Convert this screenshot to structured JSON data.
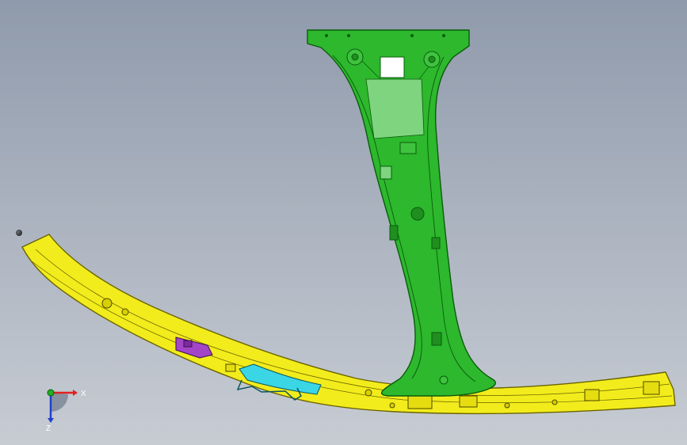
{
  "viewport": {
    "background_top": "#8f9aab",
    "background_bottom": "#c7ccd3"
  },
  "parts": {
    "pillar": {
      "name_icon": "b-pillar-part",
      "color": "#2db82d",
      "edge": "#0b5c0b"
    },
    "rail": {
      "name_icon": "roof-rail-part",
      "color": "#f2ec1c",
      "edge": "#6b6400"
    },
    "bracket_cyan": {
      "color": "#3ad6e6"
    },
    "bracket_purple": {
      "color": "#a245c9"
    }
  },
  "triad": {
    "x_label": "X",
    "z_label": "Z",
    "x_color": "#e02020",
    "y_color": "#20b020",
    "z_color": "#2040d0"
  }
}
